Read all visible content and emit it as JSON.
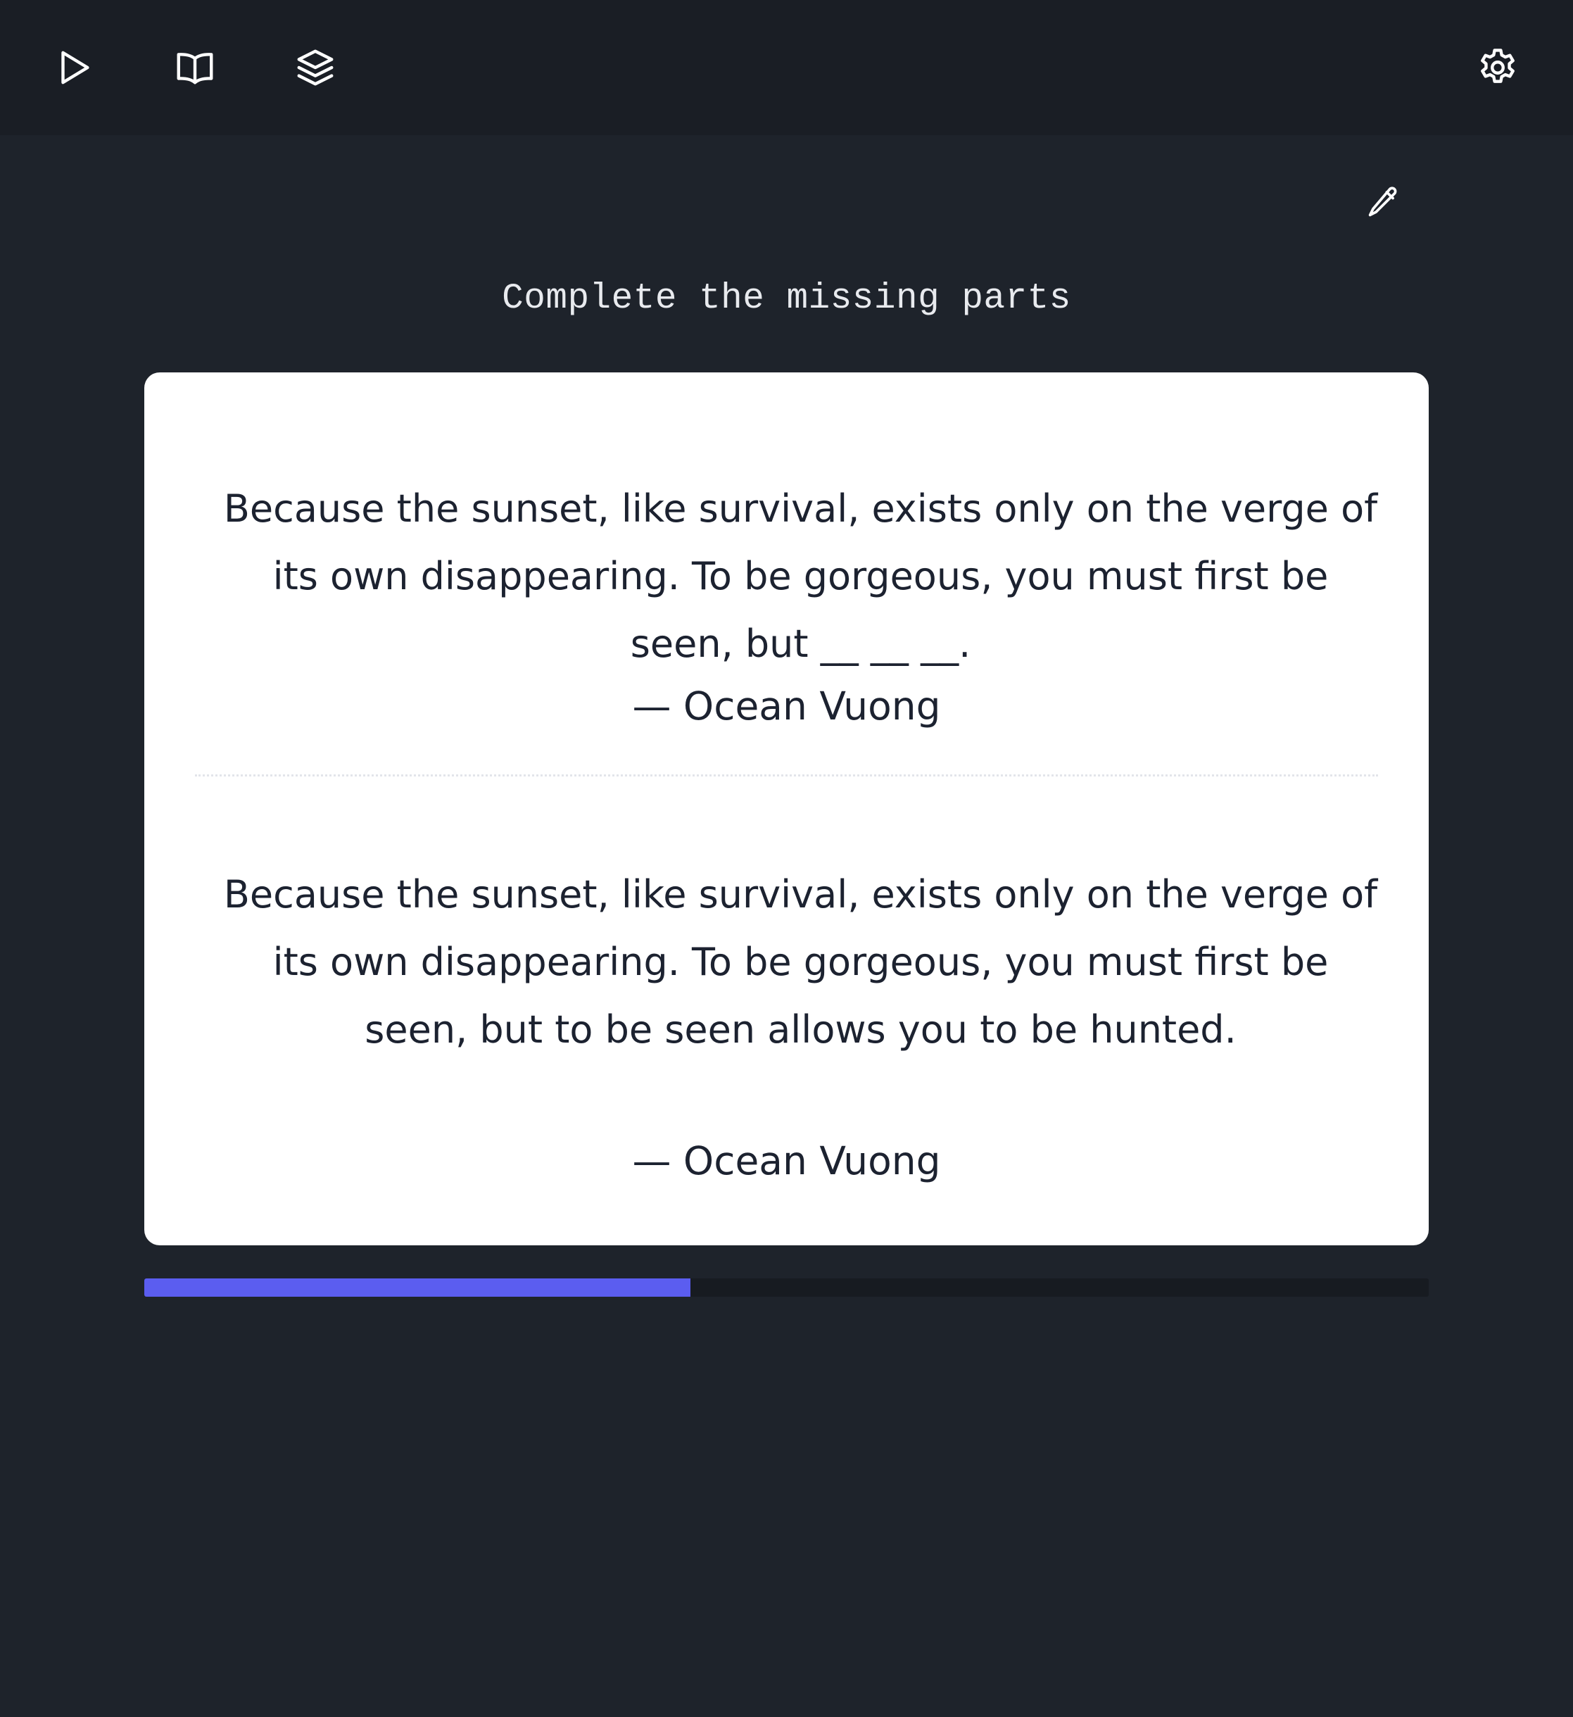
{
  "toolbar": {
    "items": [
      {
        "icon": "play-icon"
      },
      {
        "icon": "book-open-icon"
      },
      {
        "icon": "layers-icon"
      }
    ],
    "settings_icon": "gear-icon"
  },
  "edit_icon": "pencil-icon",
  "prompt": "Complete the missing parts",
  "cloze": {
    "text": "Because the sunset, like survival, exists only on the verge of its own disappearing. To be gorgeous, you must first be seen, but __ __ __.",
    "author": "— Ocean Vuong"
  },
  "answer": {
    "text": "Because the sunset, like survival, exists only on the verge of its own disappearing. To be gorgeous, you must first be seen, but to be seen allows you to be hunted.",
    "author": "— Ocean Vuong"
  },
  "progress": 0.425,
  "colors": {
    "background": "#1e232b",
    "topbar": "#1a1e25",
    "card": "#ffffff",
    "text": "#1c2230",
    "accent": "#5b5df0",
    "track": "#171b21"
  }
}
